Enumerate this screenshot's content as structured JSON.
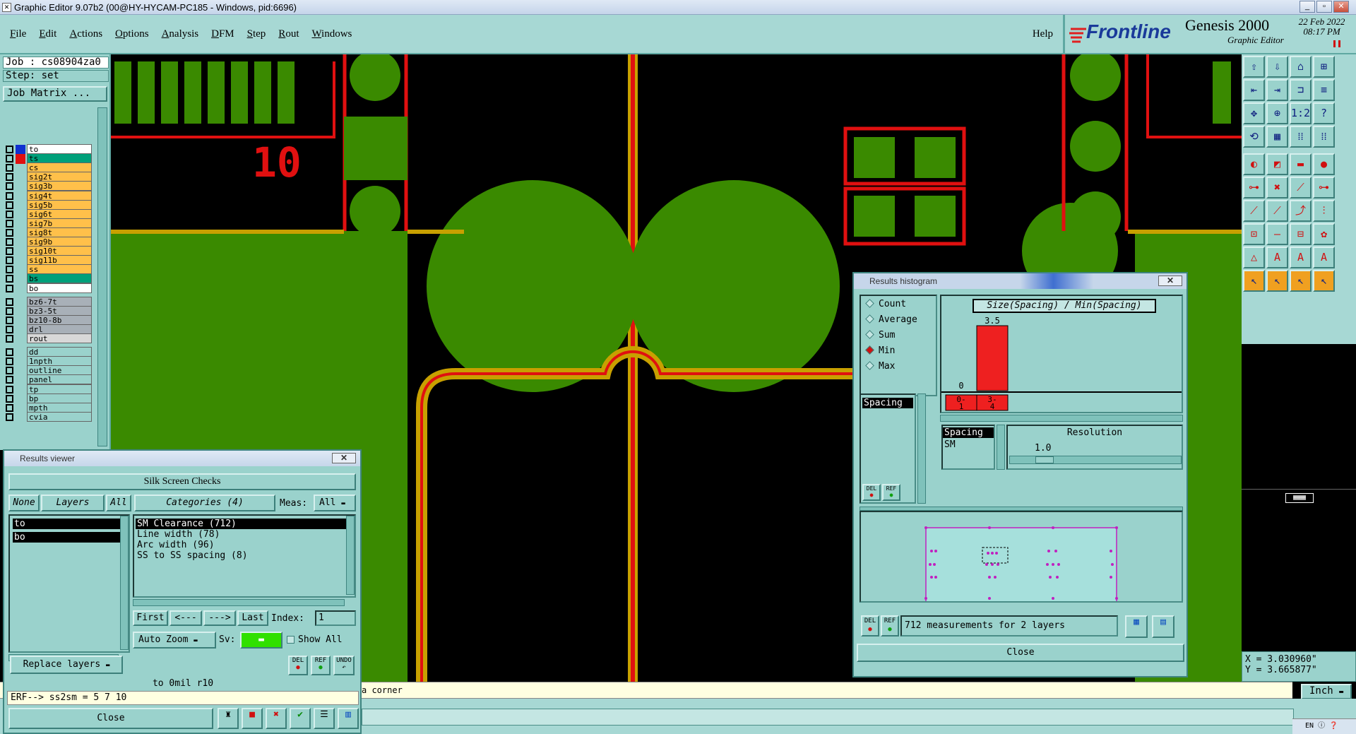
{
  "window": {
    "title": "Graphic Editor 9.07b2 (00@HY-HYCAM-PC185 - Windows, pid:6696)",
    "minimize": "_",
    "restore": "▫",
    "close": "✕"
  },
  "menu": [
    "File",
    "Edit",
    "Actions",
    "Options",
    "Analysis",
    "DFM",
    "Step",
    "Rout",
    "Windows"
  ],
  "help": "Help",
  "brand": {
    "logo": "Frontline",
    "product": "Genesis 2000",
    "sub": "Graphic Editor",
    "date": "22 Feb 2022",
    "time": "08:17 PM"
  },
  "job": {
    "job": "Job : cs08904za0",
    "step": "Step: set",
    "matrix": "Job Matrix ..."
  },
  "layers": [
    {
      "name": "to",
      "bg": "#ffffff"
    },
    {
      "name": "ts",
      "bg": "#00a07a"
    },
    {
      "name": "cs",
      "bg": "#ffc04a"
    },
    {
      "name": "sig2t",
      "bg": "#ffc04a"
    },
    {
      "name": "sig3b",
      "bg": "#ffc04a"
    },
    {
      "name": "sig4t",
      "bg": "#ffc04a"
    },
    {
      "name": "sig5b",
      "bg": "#ffc04a"
    },
    {
      "name": "sig6t",
      "bg": "#ffc04a"
    },
    {
      "name": "sig7b",
      "bg": "#ffc04a"
    },
    {
      "name": "sig8t",
      "bg": "#ffc04a"
    },
    {
      "name": "sig9b",
      "bg": "#ffc04a"
    },
    {
      "name": "sig10t",
      "bg": "#ffc04a"
    },
    {
      "name": "sig11b",
      "bg": "#ffc04a"
    },
    {
      "name": "ss",
      "bg": "#ffc04a"
    },
    {
      "name": "bs",
      "bg": "#00a07a"
    },
    {
      "name": "bo",
      "bg": "#ffffff"
    },
    {
      "name": "bz6-7t",
      "bg": "#a8b0b8"
    },
    {
      "name": "bz3-5t",
      "bg": "#a8b0b8"
    },
    {
      "name": "bz10-8b",
      "bg": "#a8b0b8"
    },
    {
      "name": "drl",
      "bg": "#a8b0b8"
    },
    {
      "name": "rout",
      "bg": "#d8d8d8"
    },
    {
      "name": "dd",
      "bg": "#9ad2cc"
    },
    {
      "name": "1npth",
      "bg": "#9ad2cc"
    },
    {
      "name": "outline",
      "bg": "#9ad2cc"
    },
    {
      "name": "panel",
      "bg": "#9ad2cc"
    },
    {
      "name": "tp",
      "bg": "#9ad2cc"
    },
    {
      "name": "bp",
      "bg": "#9ad2cc"
    },
    {
      "name": "mpth",
      "bg": "#9ad2cc"
    },
    {
      "name": "cvia",
      "bg": "#9ad2cc"
    }
  ],
  "canvas": {
    "label": "10"
  },
  "results_viewer": {
    "title": "Results viewer",
    "header": "Silk Screen Checks",
    "none": "None",
    "layers_btn": "Layers",
    "all": "All",
    "categories": "Categories (4)",
    "meas_label": "Meas:",
    "meas_value": "All",
    "layer_list": [
      "to",
      "bo"
    ],
    "cat_list": [
      "SM Clearance (712)",
      "Line width (78)",
      "Arc width (96)",
      "SS to SS spacing (8)"
    ],
    "first": "First",
    "prev": "<---",
    "next": "--->",
    "last": "Last",
    "index_label": "Index:",
    "index_value": "1",
    "auto_zoom": "Auto Zoom",
    "sv": "Sv:",
    "show_all": "Show All",
    "replace": "Replace layers",
    "del": "DEL",
    "ref": "REF",
    "undo": "UNDO",
    "info": "to  0mil  r10",
    "erf": "ERF--> ss2sm = 5 7 10",
    "close": "Close"
  },
  "histogram": {
    "title": "Results histogram",
    "options": [
      "Count",
      "Average",
      "Sum",
      "Min",
      "Max"
    ],
    "selected": "Min",
    "chart_title": "Size(Spacing) / Min(Spacing)",
    "bar_value": "3.5",
    "zero": "0",
    "bin1": "0-\n1",
    "bin2": "3-\n4",
    "list": [
      "Spacing"
    ],
    "sel_list": [
      "Spacing",
      "SM"
    ],
    "resolution": "Resolution",
    "res_value": "1.0",
    "del": "DEL",
    "ref": "REF",
    "measurements": "712 measurements for 2 layers",
    "close": "Close"
  },
  "chart_data": {
    "type": "bar",
    "categories": [
      "0-1",
      "3-4"
    ],
    "values": [
      0,
      3.5
    ],
    "title": "Size(Spacing) / Min(Spacing)"
  },
  "status": "a corner",
  "units": "Inch",
  "coords": {
    "x": "X = 3.030960\"",
    "y": "Y = 3.665877\""
  },
  "tray": {
    "lang": "EN"
  }
}
